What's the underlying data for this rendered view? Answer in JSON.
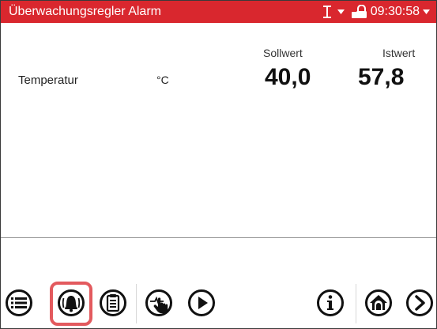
{
  "header": {
    "title": "Überwachungsregler Alarm",
    "time": "09:30:58",
    "background_color": "#d9272e"
  },
  "table": {
    "columns": [
      "Sollwert",
      "Istwert"
    ],
    "rows": [
      {
        "label": "Temperatur",
        "unit": "°C",
        "sollwert": "40,0",
        "istwert": "57,8"
      }
    ]
  },
  "toolbar": {
    "buttons": [
      {
        "icon": "menu-icon"
      },
      {
        "icon": "alarm-bell-icon",
        "highlighted": true
      },
      {
        "icon": "clipboard-list-icon"
      },
      {
        "icon": "manual-touch-icon"
      },
      {
        "icon": "play-icon"
      },
      {
        "icon": "info-icon"
      },
      {
        "icon": "home-icon"
      },
      {
        "icon": "next-arrow-icon"
      }
    ],
    "highlight_color": "#e35a5e"
  },
  "status_icons": [
    "usb-icon",
    "dropdown-arrow-icon",
    "lock-icon",
    "time-dropdown-arrow-icon"
  ]
}
